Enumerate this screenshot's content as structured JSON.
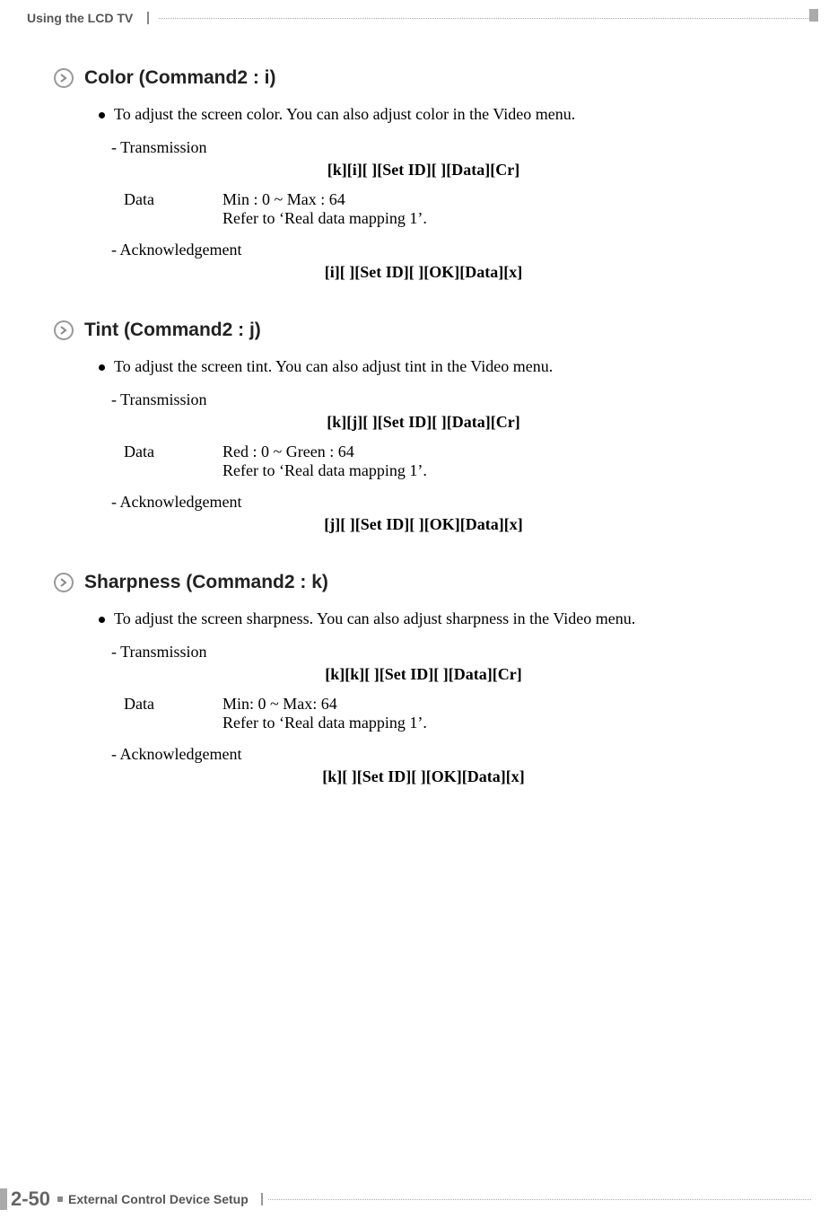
{
  "header": {
    "label": "Using the LCD TV"
  },
  "sections": [
    {
      "title": "Color (Command2 : i)",
      "bullet": "To adjust the screen color. You can also adjust color in the Video menu.",
      "transmission_label": "- Transmission",
      "transmission_code": "[k][i][ ][Set ID][ ][Data][Cr]",
      "data_label": "Data",
      "data_value1": "Min : 0 ~ Max : 64",
      "data_value2": "Refer to ‘Real data mapping 1’.",
      "ack_label": "- Acknowledgement",
      "ack_code": "[i][ ][Set ID][ ][OK][Data][x]"
    },
    {
      "title": "Tint (Command2 : j)",
      "bullet": "To adjust the screen tint. You can also adjust tint in the Video menu.",
      "transmission_label": "- Transmission",
      "transmission_code": "[k][j][ ][Set ID][ ][Data][Cr]",
      "data_label": "Data",
      "data_value1": "Red : 0 ~ Green : 64",
      "data_value2": "Refer to ‘Real data mapping 1’.",
      "ack_label": "- Acknowledgement",
      "ack_code": "[j][ ][Set ID][ ][OK][Data][x]"
    },
    {
      "title": "Sharpness (Command2 : k)",
      "bullet": "To adjust the screen sharpness. You can also adjust sharpness in the Video menu.",
      "transmission_label": "- Transmission",
      "transmission_code": "[k][k][ ][Set ID][ ][Data][Cr]",
      "data_label": "Data",
      "data_value1": "Min: 0 ~ Max: 64",
      "data_value2": "Refer to ‘Real data mapping 1’.",
      "ack_label": "- Acknowledgement",
      "ack_code": "[k][ ][Set ID][ ][OK][Data][x]"
    }
  ],
  "footer": {
    "page": "2-50",
    "label": "External Control Device Setup"
  }
}
